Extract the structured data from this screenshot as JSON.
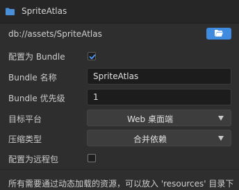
{
  "header": {
    "title": "SpriteAtlas",
    "icon": "folder-icon"
  },
  "path": {
    "value": "db://assets/SpriteAtlas",
    "open_button_icon": "folder-open-icon"
  },
  "fields": {
    "is_bundle": {
      "label": "配置为 Bundle",
      "checked": true
    },
    "bundle_name": {
      "label": "Bundle 名称",
      "value": "SpriteAtlas"
    },
    "bundle_priority": {
      "label": "Bundle 优先级",
      "value": "1"
    },
    "target_platform": {
      "label": "目标平台",
      "value": "Web 桌面端"
    },
    "compression_type": {
      "label": "压缩类型",
      "value": "合并依赖"
    },
    "is_remote": {
      "label": "配置为远程包",
      "checked": false
    }
  },
  "info_text": "所有需要通过动态加载的资源，可以放入 'resources' 目录下",
  "colors": {
    "accent": "#3f8be0",
    "background": "#2e2e2e",
    "header_bg": "#262626"
  }
}
